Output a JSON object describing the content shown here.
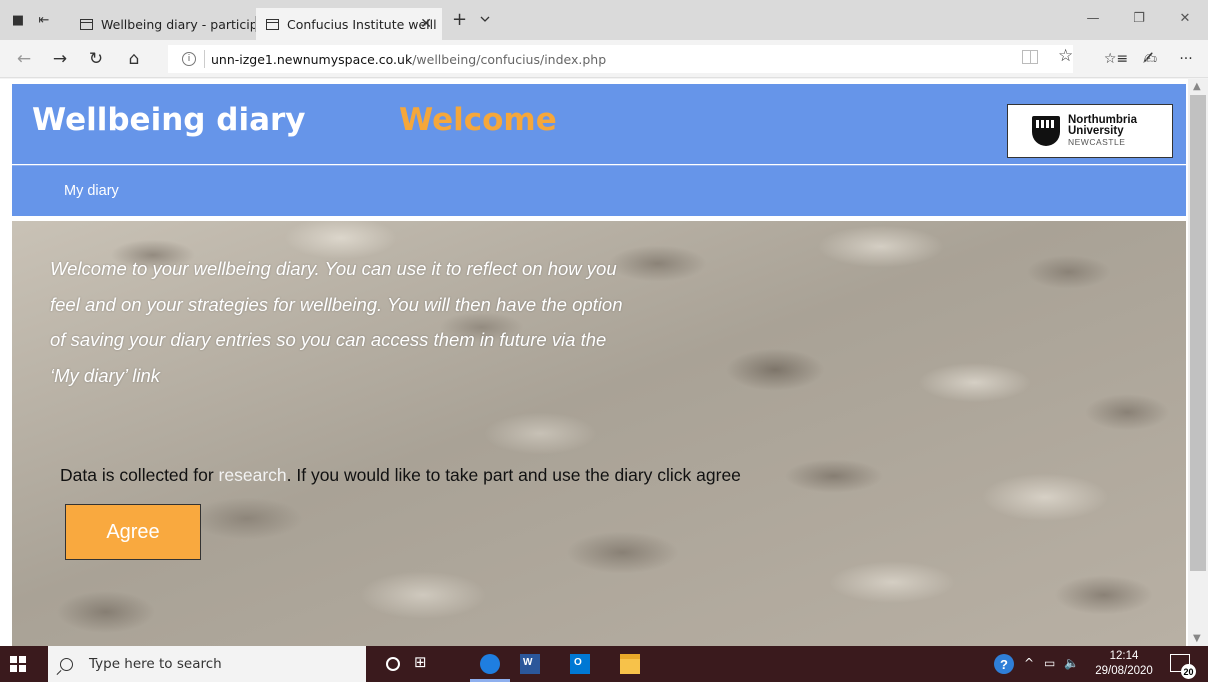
{
  "browser": {
    "tabs": [
      {
        "title": "Wellbeing diary - participan",
        "active": false
      },
      {
        "title": "Confucius Institute welll",
        "active": true
      }
    ],
    "new_tab_symbol": "+",
    "tab_list_symbol": "∨",
    "close_symbol": "✕",
    "window_controls": {
      "minimize": "—",
      "restore": "❐",
      "close": "✕"
    },
    "nav": {
      "back": "←",
      "forward": "→",
      "refresh": "↻",
      "home": "⌂"
    },
    "address": {
      "info_symbol": "i",
      "host": "unn-izge1.newnumyspace.co.uk",
      "path": "/wellbeing/confucius/index.php"
    },
    "toolbar": {
      "favorite": "☆",
      "favorites_hub": "☆≡",
      "notes": "✍",
      "more": "···"
    }
  },
  "site": {
    "title": "Wellbeing diary",
    "welcome": "Welcome",
    "logo": {
      "line1": "Northumbria",
      "line2": "University",
      "line3": "NEWCASTLE"
    },
    "nav": {
      "my_diary": "My diary"
    },
    "hero": {
      "intro": "Welcome to your wellbeing diary. You can use it to reflect on how you feel and on your strategies for wellbeing. You will then have the option of saving your diary entries so you can access them in future via the ‘My diary’ link",
      "research_prefix": "Data is collected for ",
      "research_link": "research",
      "research_suffix": ". If you would like to take part and use the diary click agree",
      "agree_label": "Agree"
    }
  },
  "taskbar": {
    "search_placeholder": "Type here to search",
    "taskview_symbol": "⊞",
    "tray_chevron": "^",
    "tray_battery": "▭",
    "tray_volume": "🔈",
    "help_symbol": "?",
    "time": "12:14",
    "date": "29/08/2020",
    "notification_count": "20"
  },
  "colors": {
    "header_blue": "#6695e9",
    "welcome_orange": "#f5a73b",
    "agree_orange": "#f9a93f",
    "taskbar": "#3a1a1d"
  }
}
